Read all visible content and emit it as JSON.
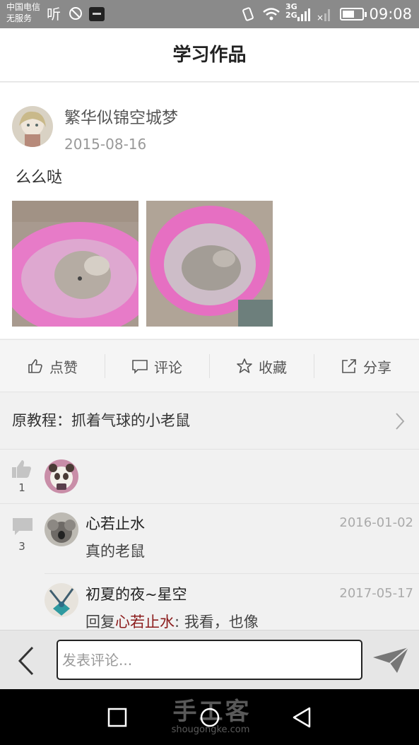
{
  "status_bar": {
    "carrier_line1": "中国电信",
    "carrier_line2": "无服务",
    "hd_label": "听",
    "net_label": "3G\n2G",
    "time": "09:08",
    "battery_level": 0.6
  },
  "header": {
    "title": "学习作品"
  },
  "post": {
    "author": "繁华似锦空城梦",
    "date": "2015-08-16",
    "text": "么么哒"
  },
  "actions": [
    {
      "label": "点赞",
      "icon": "thumbs-up-icon"
    },
    {
      "label": "评论",
      "icon": "comment-icon"
    },
    {
      "label": "收藏",
      "icon": "star-icon"
    },
    {
      "label": "分享",
      "icon": "share-icon"
    }
  ],
  "tutorial": {
    "label": "原教程：抓着气球的小老鼠"
  },
  "likes": {
    "count": "1"
  },
  "comments": {
    "count": "3",
    "items": [
      {
        "name": "心若止水",
        "date": "2016-01-02",
        "text": "真的老鼠"
      },
      {
        "name": "初夏的夜~星空",
        "date": "2017-05-17",
        "reply_prefix": "回复",
        "reply_to": "心若止水",
        "reply_text": ": 我看，也像"
      }
    ]
  },
  "input": {
    "placeholder": "发表评论..."
  },
  "watermark": {
    "main": "手工客",
    "sub": "shougongke.com"
  },
  "colors": {
    "reply_link": "#8b1c1c",
    "photo_pink": "#e86fc3"
  }
}
